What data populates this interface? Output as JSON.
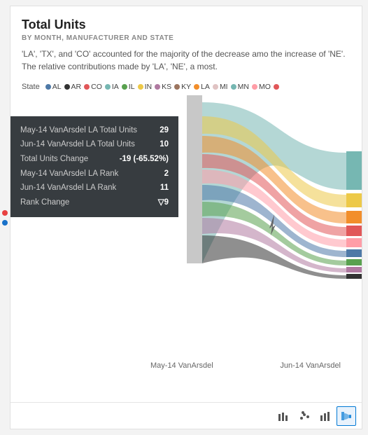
{
  "card": {
    "title": "Total Units",
    "subtitle": "BY MONTH, MANUFACTURER AND STATE",
    "description": "'LA', 'TX', and 'CO' accounted for the majority of the decrease amo the increase of 'NE'. The relative contributions made by 'LA', 'NE', a most."
  },
  "legend": {
    "label": "State",
    "items": [
      {
        "id": "AL",
        "color": "#4e79a7"
      },
      {
        "id": "AR",
        "color": "#333333"
      },
      {
        "id": "CO",
        "color": "#e15759"
      },
      {
        "id": "IA",
        "color": "#76b7b2"
      },
      {
        "id": "IL",
        "color": "#59a14f"
      },
      {
        "id": "IN",
        "color": "#edc948"
      },
      {
        "id": "KS",
        "color": "#b07aa1"
      },
      {
        "id": "KY",
        "color": "#9c755f"
      },
      {
        "id": "LA",
        "color": "#f28e2b"
      },
      {
        "id": "MI",
        "color": "#e0c3c3"
      },
      {
        "id": "MN",
        "color": "#76b7b2"
      },
      {
        "id": "MO",
        "color": "#ff9da7"
      }
    ]
  },
  "tooltip": {
    "rows": [
      {
        "key": "May-14 VanArsdel LA Total Units",
        "value": "29"
      },
      {
        "key": "Jun-14 VanArsdel LA Total Units",
        "value": "10"
      },
      {
        "key": "Total Units Change",
        "value": "-19 (-65.52%)"
      },
      {
        "key": "May-14 VanArsdel LA Rank",
        "value": "2"
      },
      {
        "key": "Jun-14 VanArsdel LA Rank",
        "value": "11"
      },
      {
        "key": "Rank Change",
        "value": "▽9"
      }
    ]
  },
  "chart": {
    "left_label": "May-14 VanArsdel",
    "right_label": "Jun-14 VanArsdel"
  },
  "toolbar": {
    "buttons": [
      {
        "id": "bar-chart",
        "icon": "▐▐",
        "active": false
      },
      {
        "id": "scatter",
        "icon": "⁘",
        "active": false
      },
      {
        "id": "column-chart",
        "icon": "▋▊▉",
        "active": false
      },
      {
        "id": "sankey",
        "icon": "⊟",
        "active": true
      }
    ]
  },
  "sidebar": {
    "dots": [
      {
        "color": "#e84141"
      },
      {
        "color": "#1871c9"
      }
    ]
  }
}
